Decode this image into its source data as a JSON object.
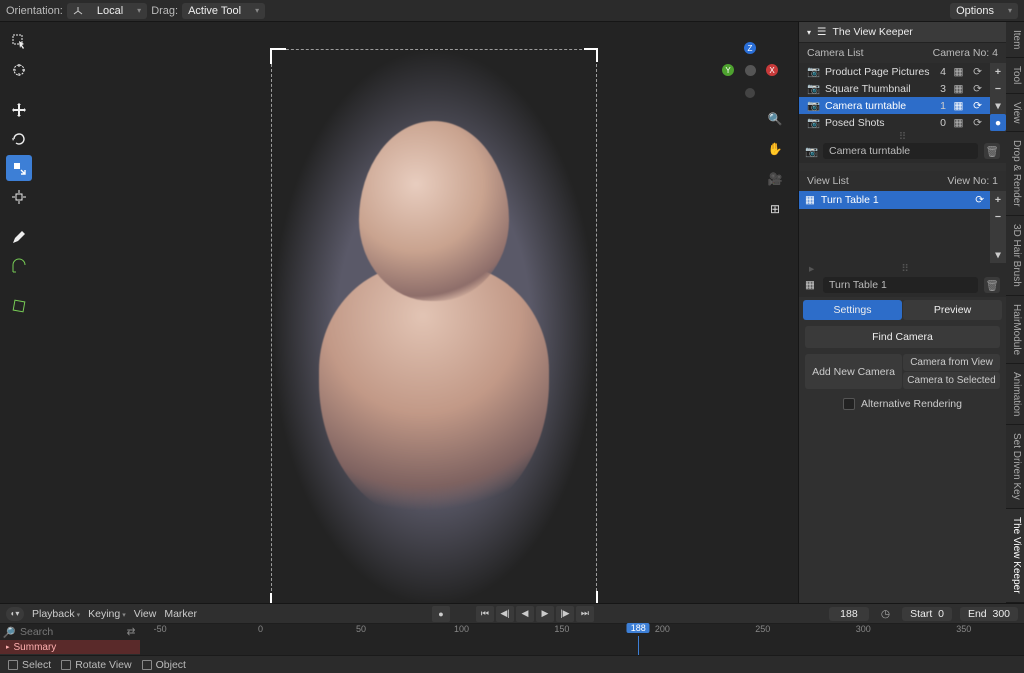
{
  "topbar": {
    "orientation_label": "Orientation:",
    "orientation_value": "Local",
    "drag_label": "Drag:",
    "drag_value": "Active Tool",
    "options": "Options"
  },
  "gizmo": {
    "x": "X",
    "y": "Y",
    "z": "Z"
  },
  "sidetabs": [
    "Item",
    "Tool",
    "View",
    "Drop & Render",
    "3D Hair Brush",
    "HairModule",
    "Animation",
    "Set Driven Key",
    "The View Keeper"
  ],
  "panel": {
    "title": "The View Keeper",
    "camera_list_label": "Camera List",
    "camera_no_label": "Camera No:",
    "camera_no": "4",
    "cameras": [
      {
        "name": "Product Page Pictures",
        "count": "4"
      },
      {
        "name": "Square Thumbnail",
        "count": "3"
      },
      {
        "name": "Camera turntable",
        "count": "1"
      },
      {
        "name": "Posed Shots",
        "count": "0"
      }
    ],
    "camera_selected_index": 2,
    "camera_field": "Camera turntable",
    "view_list_label": "View List",
    "view_no_label": "View No:",
    "view_no": "1",
    "views": [
      {
        "name": "Turn Table 1"
      }
    ],
    "view_field": "Turn Table 1",
    "settings_btn": "Settings",
    "preview_btn": "Preview",
    "find_camera": "Find Camera",
    "add_new_camera": "Add New Camera",
    "camera_from_view": "Camera from View",
    "camera_to_selected": "Camera to Selected",
    "alt_rendering": "Alternative Rendering"
  },
  "bottom": {
    "menu": {
      "playback": "Playback",
      "keying": "Keying",
      "view": "View",
      "marker": "Marker"
    },
    "frame_current": "188",
    "start_label": "Start",
    "start_value": "0",
    "end_label": "End",
    "end_value": "300",
    "search_placeholder": "Search",
    "summary": "Summary",
    "ticks": [
      "-50",
      "0",
      "50",
      "100",
      "150",
      "200",
      "250",
      "300",
      "350"
    ]
  },
  "status": {
    "select": "Select",
    "rotate": "Rotate View",
    "object": "Object"
  }
}
